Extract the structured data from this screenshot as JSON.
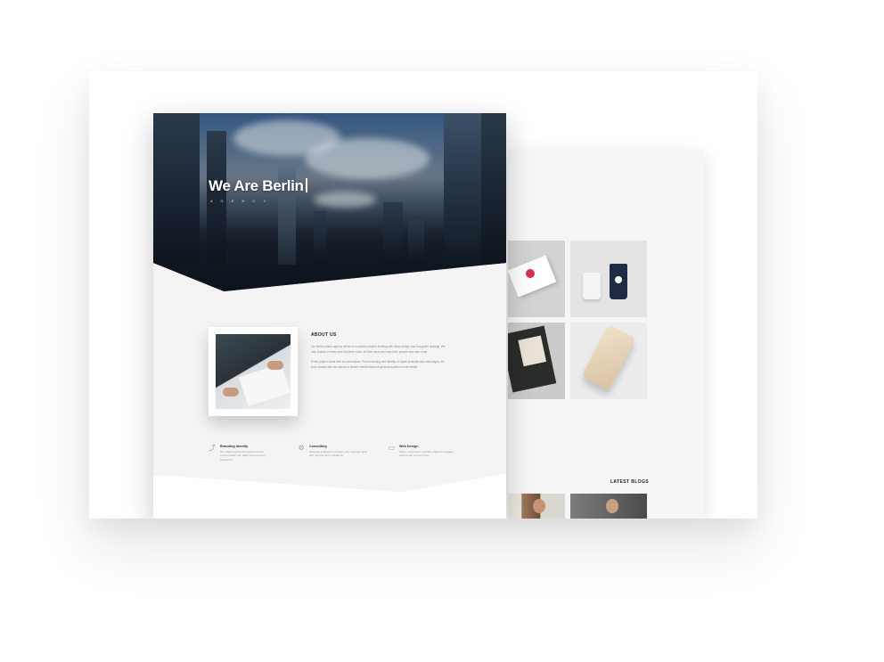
{
  "hero": {
    "title": "We Are Berlin",
    "subtitle": "A G E N C Y"
  },
  "about": {
    "heading": "ABOUT US",
    "paragraph_1": "Our Berlin based agency strives to combine creative thinking with clean design and thoughtful strategy. We help brands of every size find their voice, tell their story and reach the people who care most.",
    "paragraph_2": "Every project starts with a conversation. From branding and identity to digital products and campaigns, we work closely with our clients to deliver results that look great and perform even better."
  },
  "features": [
    {
      "icon": "share-icon",
      "title": "Branding Identity",
      "body": "We shape brands that stand out and communicate with clarity across every touchpoint."
    },
    {
      "icon": "gear-icon",
      "title": "Consulting",
      "body": "Strategic guidance that helps your business grow with purpose and confidence."
    },
    {
      "icon": "monitor-icon",
      "title": "Web Design",
      "body": "Clean, responsive websites crafted to engage visitors and convert them."
    }
  ],
  "portfolio": {
    "items": [
      "book-mockup",
      "coffee-cups",
      "magazine",
      "phone-gold"
    ]
  },
  "blog": {
    "heading": "LATEST BLOGS"
  },
  "colors": {
    "page_background": "#f4f4f4",
    "hero_overlay": "#0f151d",
    "accent_red": "#d9334e",
    "navy": "#1f2a44"
  }
}
